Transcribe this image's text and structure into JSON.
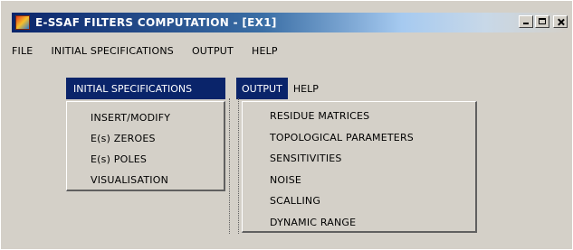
{
  "window": {
    "title": "E-SSAF FILTERS COMPUTATION - [EX1]",
    "accent": "#0a246a"
  },
  "menubar": {
    "items": [
      "FILE",
      "INITIAL SPECIFICATIONS",
      "OUTPUT",
      "HELP"
    ]
  },
  "submenu_header": {
    "initial_specifications": "INITIAL SPECIFICATIONS",
    "output": "OUTPUT",
    "help": "HELP"
  },
  "initial_specifications_menu": {
    "items": [
      "INSERT/MODIFY",
      "E(s) ZEROES",
      "E(s) POLES",
      "VISUALISATION"
    ]
  },
  "output_menu": {
    "items": [
      "RESIDUE MATRICES",
      "TOPOLOGICAL PARAMETERS",
      "SENSITIVITIES",
      "NOISE",
      "SCALLING",
      "DYNAMIC RANGE"
    ]
  }
}
